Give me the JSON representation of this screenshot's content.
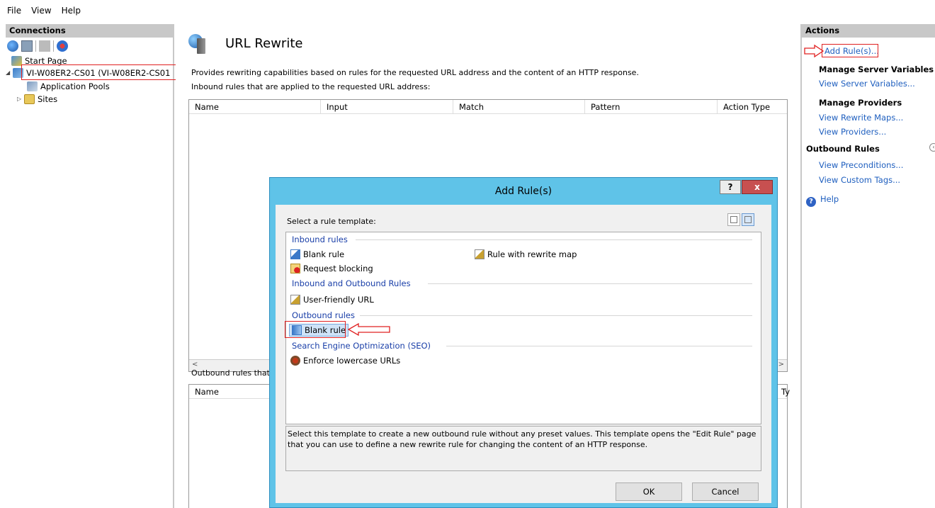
{
  "menu": [
    "File",
    "View",
    "Help"
  ],
  "connections": {
    "header": "Connections",
    "tree": [
      {
        "label": "Start Page"
      },
      {
        "label": "VI-W08ER2-CS01 (VI-W08ER2-CS01"
      },
      {
        "label": "Application Pools"
      },
      {
        "label": "Sites"
      }
    ]
  },
  "main": {
    "title": "URL Rewrite",
    "description": "Provides rewriting capabilities based on rules for the requested URL address and the content of an HTTP response.",
    "inbound_label": "Inbound rules that are applied to the requested URL address:",
    "inbound_columns": [
      "Name",
      "Input",
      "Match",
      "Pattern",
      "Action Type"
    ],
    "outbound_label": "Outbound rules that",
    "outbound_columns": [
      "Name",
      "Ty"
    ]
  },
  "actions": {
    "header": "Actions",
    "add_rules": "Add Rule(s)...",
    "manage_server_vars": "Manage Server Variables",
    "view_server_vars": "View Server Variables...",
    "manage_providers": "Manage Providers",
    "view_rewrite_maps": "View Rewrite Maps...",
    "view_providers": "View Providers...",
    "outbound_rules": "Outbound Rules",
    "view_preconditions": "View Preconditions...",
    "view_custom_tags": "View Custom Tags...",
    "help": "Help"
  },
  "dialog": {
    "title": "Add Rule(s)",
    "help_label": "?",
    "close_label": "x",
    "select_label": "Select a rule template:",
    "groups": {
      "inbound": "Inbound rules",
      "inout": "Inbound and Outbound Rules",
      "outbound": "Outbound rules",
      "seo": "Search Engine Optimization (SEO)"
    },
    "templates": {
      "blank_inbound": "Blank rule",
      "rewrite_map": "Rule with rewrite map",
      "request_blocking": "Request blocking",
      "user_friendly": "User-friendly URL",
      "blank_outbound": "Blank rule",
      "lowercase": "Enforce lowercase URLs"
    },
    "description": "Select this template to create a new outbound rule without any preset values. This template opens the \"Edit Rule\" page that you can use to define a new rewrite rule for changing the content of an HTTP response.",
    "ok": "OK",
    "cancel": "Cancel"
  },
  "colors": {
    "dialog_frame": "#5fc3e8",
    "link": "#1f5fbf",
    "highlight": "#e02020"
  }
}
